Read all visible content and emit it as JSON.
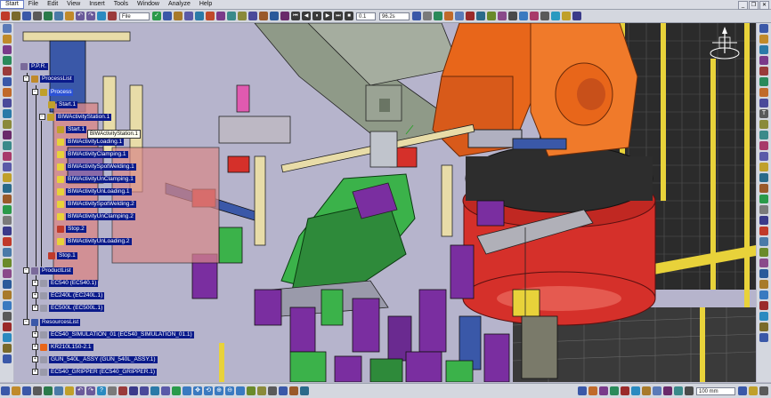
{
  "menu": {
    "items": [
      {
        "label": "Start",
        "active": true
      },
      {
        "label": "File"
      },
      {
        "label": "Edit"
      },
      {
        "label": "View"
      },
      {
        "label": "Insert"
      },
      {
        "label": "Tools"
      },
      {
        "label": "Window"
      },
      {
        "label": "Analyze"
      },
      {
        "label": "Help"
      }
    ]
  },
  "toolbar": {
    "file_select": "File",
    "step_value": "0.1",
    "time_value": "96.2s"
  },
  "statusbar": {
    "zoom_value": "100 mm"
  },
  "tree": {
    "root": "P.P.R.",
    "process_list": "ProcessList",
    "process": "Process",
    "start1": "Start.1",
    "station": "BIWActivityStation.1",
    "start_child": "Start.1",
    "tooltip": "BIWActivityStation.1",
    "activities": [
      "BIWActivityLoading.1",
      "BIWActivityClamping.1",
      "BIWActivitySpotWelding.1",
      "BIWActivityUnClamping.1",
      "BIWActivityUnLoading.1",
      "BIWActivitySpotWelding.2",
      "BIWActivityUnClamping.2",
      "Stop.2",
      "BIWActivityUnLoading.2",
      "Stop.1"
    ],
    "product_list": "ProductList",
    "products": [
      "EC540 (EC540.1)",
      "EC240L (EC240L.1)",
      "EC500L (EC500L.1)"
    ],
    "resources_list": "ResourcesList",
    "resources": [
      "EC540_SIMULATION_01 (EC540_SIMULATION_01.1)",
      "KR210L150-2.1",
      "GUN_540L_ASSY (GUN_540L_ASSY.1)",
      "EC540_GRIPPER (EC540_GRIPPER.1)"
    ]
  },
  "colors": {
    "robot_orange": "#e8661a",
    "robot_base_red": "#d5302a",
    "fence_yellow": "#e8d23a",
    "tree_label_bg": "#0a1a8a",
    "fixture_purple": "#7a2ea0",
    "fixture_green": "#3bb24a",
    "viewport_bg": "#b6b4cc"
  },
  "icons": [
    "compass-icon",
    "save-icon",
    "undo-icon",
    "redo-icon",
    "play-icon",
    "pause-icon",
    "stop-icon",
    "zoom-icon",
    "rotate-icon",
    "pan-icon"
  ]
}
